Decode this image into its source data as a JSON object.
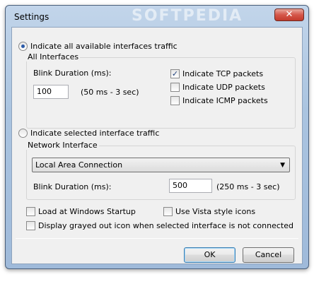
{
  "window": {
    "title": "Settings",
    "close_glyph": "✕",
    "watermark": "SOFTPEDIA"
  },
  "all_interfaces": {
    "radio_label": "Indicate all available interfaces traffic",
    "group_label": "All Interfaces",
    "blink_label": "Blink Duration (ms):",
    "blink_value": "100",
    "blink_range": "(50 ms - 3 sec)",
    "tcp_label": "Indicate TCP packets",
    "udp_label": "Indicate UDP packets",
    "icmp_label": "Indicate ICMP packets"
  },
  "selected_interface": {
    "radio_label": "Indicate selected interface traffic",
    "group_label": "Network Interface",
    "dropdown_value": "Local Area Connection",
    "blink_label": "Blink Duration (ms):",
    "blink_value": "500",
    "blink_range": "(250 ms - 3 sec)"
  },
  "options": {
    "startup_label": "Load at Windows Startup",
    "vista_label": "Use Vista style icons",
    "grayed_label": "Display grayed out icon when selected interface is not connected"
  },
  "buttons": {
    "ok": "OK",
    "cancel": "Cancel"
  },
  "colors": {
    "accent": "#2a5aa8",
    "titlebar": "#aac4e0",
    "close": "#c23a2c"
  }
}
